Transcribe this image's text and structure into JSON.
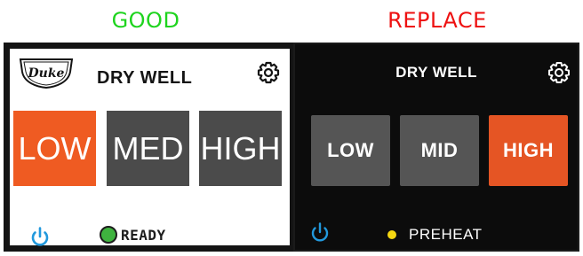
{
  "headings": {
    "good": "GOOD",
    "replace": "REPLACE"
  },
  "good_panel": {
    "logo_text": "Duke",
    "title": "DRY WELL",
    "buttons": {
      "low": "LOW",
      "med": "MED",
      "high": "HIGH"
    },
    "selected": "LOW",
    "status": "READY",
    "status_indicator_color": "#3fb33f"
  },
  "replace_panel": {
    "title": "DRY WELL",
    "buttons": {
      "low": "LOW",
      "mid": "MID",
      "high": "HIGH"
    },
    "selected": "HIGH",
    "status": "PREHEAT",
    "status_indicator_color": "#f5d711"
  },
  "icons": {
    "settings": "gear-icon",
    "power": "power-icon"
  },
  "colors": {
    "good_heading": "#1ed41e",
    "replace_heading": "#ee1111",
    "active_button_good": "#ef5b22",
    "active_button_replace": "#e55524",
    "inactive_button": "#4b4b4b",
    "power_icon": "#2299dd"
  }
}
